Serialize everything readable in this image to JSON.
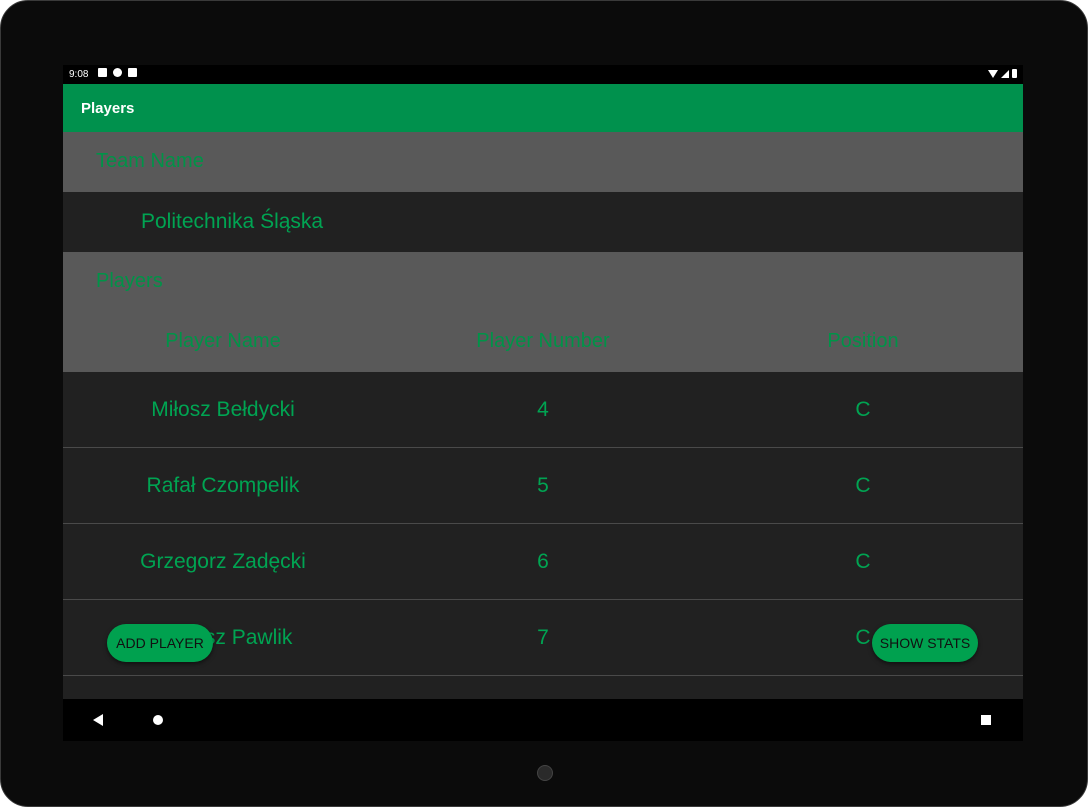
{
  "status_bar": {
    "time": "9:08",
    "notification_icons": [
      "a-icon",
      "p-icon",
      "sd-card-icon"
    ],
    "system_icons": [
      "wifi-icon",
      "signal-icon",
      "battery-icon"
    ]
  },
  "app_bar": {
    "title": "Players"
  },
  "team_section": {
    "header": "Team Name",
    "team_name": "Politechnika Śląska"
  },
  "players_section": {
    "header": "Players",
    "columns": [
      "Player Name",
      "Player Number",
      "Position"
    ],
    "rows": [
      {
        "name": "Miłosz Bełdycki",
        "number": "4",
        "position": "C"
      },
      {
        "name": "Rafał Czompelik",
        "number": "5",
        "position": "C"
      },
      {
        "name": "Grzegorz Zadęcki",
        "number": "6",
        "position": "C"
      },
      {
        "name": "Tomasz Pawlik",
        "number": "7",
        "position": "C"
      }
    ]
  },
  "buttons": {
    "add_player": "ADD PLAYER",
    "show_stats": "SHOW STATS"
  },
  "colors": {
    "accent": "#00914D",
    "text_green": "#00A452",
    "header_gray": "#595959",
    "background": "#212121"
  }
}
